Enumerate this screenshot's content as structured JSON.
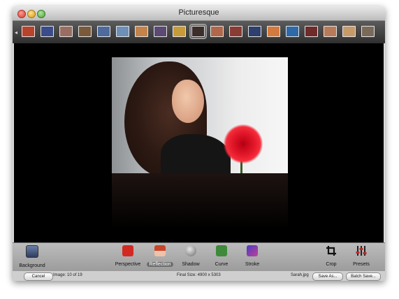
{
  "window": {
    "title": "Picturesque"
  },
  "filmstrip": {
    "left_arrow": "◂",
    "thumbnails": [
      {
        "color": "#b8432c"
      },
      {
        "color": "#3a4d8a"
      },
      {
        "color": "#9a6d63"
      },
      {
        "color": "#7a5a3c"
      },
      {
        "color": "#4f6b9e"
      },
      {
        "color": "#6d8fb8"
      },
      {
        "color": "#c4834b"
      },
      {
        "color": "#5b4a72"
      },
      {
        "color": "#c79a3a"
      },
      {
        "color": "#3c2e2a",
        "selected": true
      },
      {
        "color": "#b0674a"
      },
      {
        "color": "#8a3b34"
      },
      {
        "color": "#2f3f6e"
      },
      {
        "color": "#d27a3e"
      },
      {
        "color": "#2f6aa8"
      },
      {
        "color": "#6f2a2a"
      },
      {
        "color": "#b97a5a"
      },
      {
        "color": "#c79a6a"
      },
      {
        "color": "#7a6a5a"
      }
    ]
  },
  "toolbar": {
    "background": {
      "label": "Background"
    },
    "tools": [
      {
        "id": "perspective",
        "label": "Perspective",
        "icon": "red-cube-icon",
        "color": "#d22a22"
      },
      {
        "id": "reflection",
        "label": "Reflection",
        "icon": "reflection-icon",
        "color": "#c9452a",
        "active": true
      },
      {
        "id": "shadow",
        "label": "Shadow",
        "icon": "gray-sphere-icon",
        "color": "#8a8a8a"
      },
      {
        "id": "curve",
        "label": "Curve",
        "icon": "curve-icon",
        "color": "#3e8a3a"
      },
      {
        "id": "stroke",
        "label": "Stroke",
        "icon": "stroke-icon",
        "color": "#6a5ad0"
      }
    ],
    "crop": {
      "label": "Crop",
      "icon": "crop-icon"
    },
    "presets": {
      "label": "Presets",
      "icon": "presets-icon"
    }
  },
  "status": {
    "cancel": "Cancel",
    "image_counter": "Image: 10 of 19",
    "final_size": "Final Size: 4900 x 5303",
    "filename": "Sarah.jpg",
    "save_as": "Save As...",
    "batch_save": "Batch Save..."
  }
}
